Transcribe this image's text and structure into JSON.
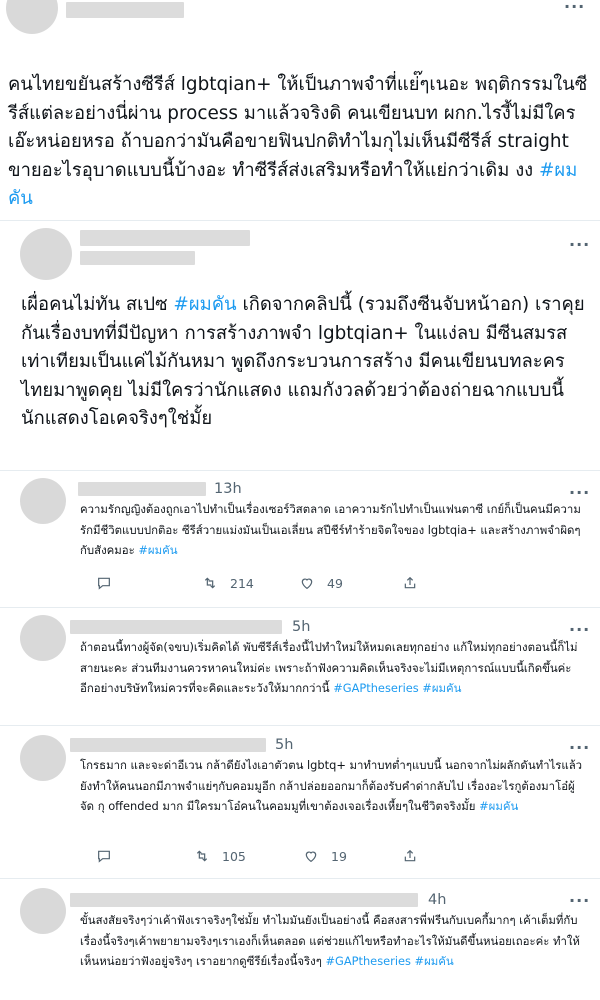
{
  "tweets": [
    {
      "text_before": "คนไทยขยันสร้างซีรีส์ lgbtqian+ ให้เป็นภาพจำที่แย่๊ๆเนอะ พฤติกรรมในซีรีส์แต่ละอย่างนี่ผ่าน process มาแล้วจริงดิ คนเขียนบท ผกก.ไรงี้ไม่มีใครเอ๊ะหน่อยหรอ ถ้าบอกว่ามันคือขายฟินปกติทำไมกุไม่เห็นมีซีรีส์ straight ขายอะไรอุบาดแบบนี้บ้างอะ ทำซีรีส์ส่งเสริมหรือทำให้แย่กว่าเดิม งง ",
      "hashtag": "#ผมคัน"
    },
    {
      "text_before": "เผื่อคนไม่ทัน สเปซ ",
      "hashtag": "#ผมคัน",
      "text_after": " เกิดจากคลิปนี้ (รวมถึงซีนจับหน้าอก) เราคุยกันเรื่องบทที่มีปัญหา การสร้างภาพจำ lgbtqian+ ในแง่ลบ มีซีนสมรสเท่าเทียมเป็นแค่ไม้กันหมา พูดถึงกระบวนการสร้าง มีคนเขียนบทละครไทยมาพูดคุย ไม่มีใครว่านักแสดง แถมกังวลด้วยว่าต้องถ่ายฉากแบบนี้ นักแสดงโอเคจริงๆใช่มั้ย"
    }
  ],
  "replies": [
    {
      "time": "13h",
      "text_before": "ความรักญญิงต้องถูกเอาไปทำเป็นเรื่องเซอร์วิสตลาด เอาความรักไปทำเป็นแฟนตาซี เกย์ก็เป็นคนมีความรักมีชีวิตแบบปกติอะ ซีรีส์วายแม่งมันเป็นเอเลี่ยน สปีชีร์ทำร้ายจิตใจของ lgbtqia+ และสร้างภาพจำผิดๆกับสังคมอะ ",
      "hashtags": "#ผมคัน",
      "retweets": "214",
      "likes": "49"
    },
    {
      "time": "5h",
      "text_before": "ถ้าตอนนี้ทางผู้จัด(จขบ)เริ่มคิดได้ พับซีรีส์เรื่องนี้ไปทำใหม่ให้หมดเลยทุกอย่าง แก้ใหม่ทุกอย่างตอนนี้ก็ไม่สายนะคะ ส่วนทีมงานควรหาคนใหม่ค่ะ เพราะถ้าฟังความคิดเห็นจริงจะไม่มีเหตุการณ์แบบนี้เกิดขึ้นค่ะ อีกอย่างบริษัทใหม่ควรที่จะคิดและระวังให้มากกว่านี้ ",
      "hashtags": "#GAPtheseries #ผมคัน"
    },
    {
      "time": "5h",
      "text_before": "โกรธมาก และจะด่าอีเวน กล้าดียังไงเอาตัวตน lgbtq+ มาทำบทต่ำๆแบบนี้ นอกจากไม่ผลักดันทำไรแล้วยังทำให้คนนอกมีภาพจำแย่ๆกับคอมมูอีก กล้าปล่อยออกมาก็ต้องรับคำด่ากลับไป เรื่องอะไรกูต้องมาโอ๋ผู้จัด กุ offended มาก มีใครมาโอ๋คนในคอมมูที่เขาต้องเจอเรื่องเหี้ยๆในชีวิตจริงมั้ย ",
      "hashtags": "#ผมคัน",
      "retweets": "105",
      "likes": "19"
    },
    {
      "time": "4h",
      "text_before": "ขั้นสงสัยจริงๆว่าเค้าฟังเราจริงๆใช่มั้ย ทำไมมันยังเป็นอย่างนี้ คือสงสารพี่ฟรีนกับเบคกี้มากๆ เค้าเต็มที่กับเรื่องนี้จริงๆเค้าพยายามจริงๆเราเองก็เห็นตลอด แต่ช่วยแก้ไขหรือทำอะไรให้มันดีขึ้นหน่อยเถอะค่ะ ทำให้เห็นหน่อยว่าฟังอยู่จริงๆ เราอยากดูซีรีย์เรื่องนี้จริงๆ ",
      "hashtags": "#GAPtheseries #ผมคัน"
    }
  ],
  "icons": {
    "reply": "reply-icon",
    "retweet": "retweet-icon",
    "like": "heart-icon",
    "share": "share-icon",
    "more": "more-icon"
  },
  "colors": {
    "hashtag": "#1d9bf0",
    "secondary_text": "#536471",
    "divider": "#e6ecf0",
    "redacted": "#dcdcdc"
  }
}
